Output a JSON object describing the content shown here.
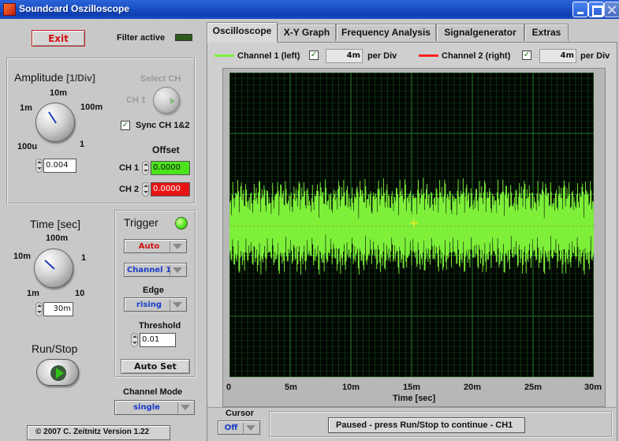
{
  "window": {
    "title": "Soundcard Oszilloscope"
  },
  "controls": {
    "exit_label": "Exit",
    "filter_label": "Filter active",
    "amplitude": {
      "title": "Amplitude",
      "title_unit": "[1/Div]",
      "ticks": [
        "10m",
        "100m",
        "1m",
        "100u",
        "1"
      ],
      "value": "0.004"
    },
    "select_ch": {
      "label": "Select CH",
      "ch_label": "CH 1"
    },
    "sync": {
      "label": "Sync CH 1&2",
      "checked": true
    },
    "offset": {
      "label": "Offset",
      "ch1_label": "CH 1",
      "ch1_value": "0.0000",
      "ch1_color": "#4be31b",
      "ch2_label": "CH 2",
      "ch2_value": "0.0000",
      "ch2_color": "#e81414"
    },
    "time": {
      "title": "Time [sec]",
      "ticks": [
        "100m",
        "10m",
        "1",
        "1m",
        "10"
      ],
      "value": "30m"
    },
    "trigger": {
      "title": "Trigger",
      "mode": "Auto",
      "channel": "Channel 1",
      "edge_label": "Edge",
      "edge": "rising",
      "threshold_label": "Threshold",
      "threshold": "0.01",
      "autoset_label": "Auto Set"
    },
    "runstop_label": "Run/Stop",
    "channel_mode": {
      "label": "Channel Mode",
      "value": "single"
    },
    "copyright": "© 2007  C. Zeitnitz Version 1.22"
  },
  "tabs": [
    {
      "label": "Oscilloscope",
      "active": true
    },
    {
      "label": "X-Y Graph",
      "active": false
    },
    {
      "label": "Frequency Analysis",
      "active": false
    },
    {
      "label": "Signalgenerator",
      "active": false
    },
    {
      "label": "Extras",
      "active": false
    }
  ],
  "legend": {
    "ch1_label": "Channel 1 (left)",
    "ch1_color": "#7ef03a",
    "ch1_div": "4m",
    "ch2_label": "Channel 2 (right)",
    "ch2_color": "#ff2020",
    "ch2_div": "4m",
    "per_div": "per Div"
  },
  "plot": {
    "xlabel": "Time [sec]",
    "ticks": [
      "0",
      "5m",
      "10m",
      "15m",
      "20m",
      "25m",
      "30m"
    ],
    "bg": "#020602",
    "grid": "#1f6a28",
    "signal": "#7ef03a"
  },
  "cursor": {
    "label": "Cursor",
    "value": "Off"
  },
  "status": "Paused - press Run/Stop to continue - CH1"
}
